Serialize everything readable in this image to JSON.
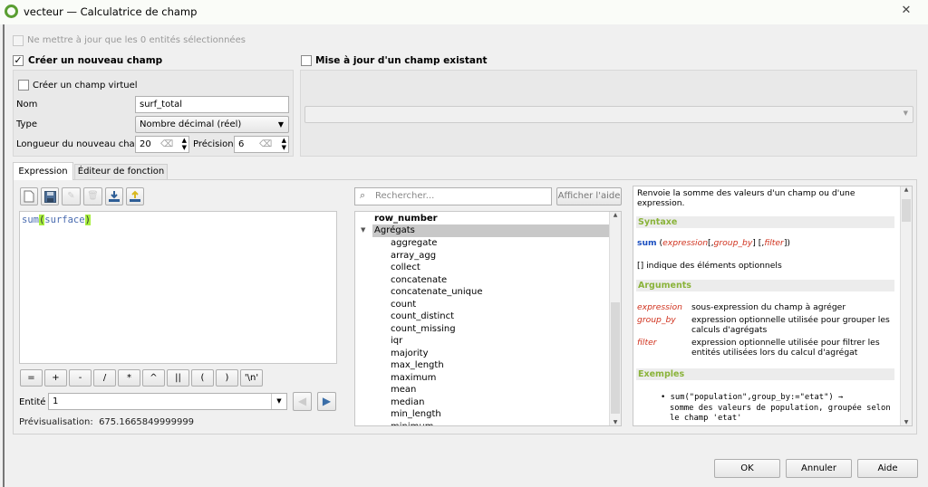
{
  "window": {
    "title": "vecteur — Calculatrice de champ",
    "close_icon": "close-icon"
  },
  "top": {
    "only_selected": "Ne mettre à jour que les 0 entités sélectionnées",
    "create_new": "Créer un nouveau champ",
    "create_new_checked": true,
    "update_existing": "Mise à jour d'un champ existant",
    "update_existing_checked": false,
    "virtual": "Créer un champ virtuel",
    "name_label": "Nom",
    "name_value": "surf_total",
    "type_label": "Type",
    "type_value": "Nombre décimal (réel)",
    "length_label": "Longueur du nouveau champ",
    "length_value": "20",
    "precision_label": "Précision",
    "precision_value": "6"
  },
  "tabs": [
    {
      "label": "Expression",
      "active": true
    },
    {
      "label": "Éditeur de fonction",
      "active": false
    }
  ],
  "editor": {
    "toolbar": [
      "new-file-icon",
      "save-icon",
      "edit-icon",
      "delete-icon",
      "import-icon",
      "export-icon"
    ],
    "code_fn": "sum",
    "code_open": "(",
    "code_arg": "surface",
    "code_close": ")",
    "operators": [
      "=",
      "+",
      "-",
      "/",
      "*",
      "^",
      "||",
      "(",
      ")",
      "'\\n'"
    ],
    "entity_label": "Entité",
    "entity_value": "1",
    "preview_label": "Prévisualisation:",
    "preview_value": "675.1665849999999"
  },
  "functions": {
    "search_placeholder": "Rechercher...",
    "help_button": "Afficher l'aide",
    "row_number": "row_number",
    "group": "Agrégats",
    "items": [
      "aggregate",
      "array_agg",
      "collect",
      "concatenate",
      "concatenate_unique",
      "count",
      "count_distinct",
      "count_missing",
      "iqr",
      "majority",
      "max_length",
      "maximum",
      "mean",
      "median",
      "min_length",
      "minimum"
    ]
  },
  "help": {
    "intro": "Renvoie la somme des valeurs d'un champ ou d'une expression.",
    "syntax_head": "Syntaxe",
    "syntax_fn": "sum",
    "syntax_p1": "(",
    "syntax_a1": "expression",
    "syntax_p2": "[,",
    "syntax_a2": "group_by",
    "syntax_p3": "] [,",
    "syntax_a3": "filter",
    "syntax_p4": "])",
    "optional_note": "[] indique des éléments optionnels",
    "args_head": "Arguments",
    "args": [
      {
        "name": "expression",
        "desc": "sous-expression du champ à agréger"
      },
      {
        "name": "group_by",
        "desc": "expression optionnelle utilisée pour grouper les calculs d'agrégats"
      },
      {
        "name": "filter",
        "desc": "expression optionnelle utilisée pour filtrer les entités utilisées lors du calcul d'agrégat"
      }
    ],
    "examples_head": "Exemples",
    "example_code": "sum(\"population\",group_by:=\"etat\") →",
    "example_desc": "somme des valeurs de population, groupée selon le champ 'etat'"
  },
  "buttons": {
    "ok": "OK",
    "cancel": "Annuler",
    "help": "Aide"
  },
  "colors": {
    "accent_green": "#8ab33a",
    "arg_red": "#d0321e",
    "fn_blue": "#1a4ec0",
    "bracket_highlight": "#a8f040",
    "selection": "#c8c8c8"
  }
}
